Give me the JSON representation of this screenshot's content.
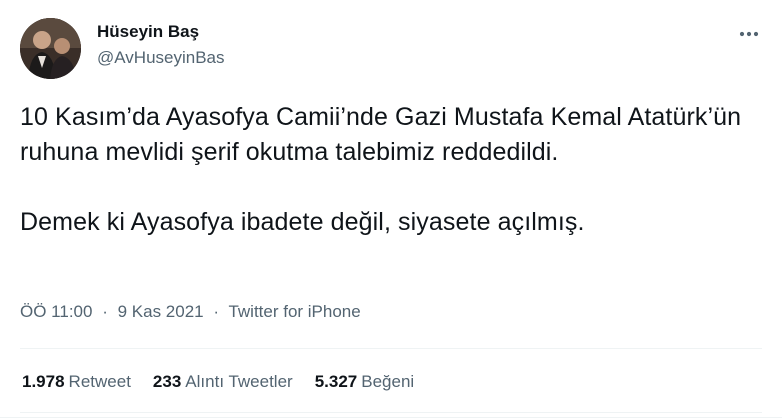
{
  "author": {
    "name": "Hüseyin Baş",
    "handle": "@AvHuseyinBas"
  },
  "more_icon": "more-horizontal-icon",
  "tweet": {
    "paragraphs": [
      "10 Kasım’da Ayasofya Camii’nde Gazi Mustafa Kemal Atatürk’ün ruhuna mevlidi şerif okutma talebimiz reddedildi.",
      "Demek ki Ayasofya ibadete değil, siyasete açılmış."
    ]
  },
  "meta": {
    "time": "ÖÖ 11:00",
    "separator": "·",
    "date": "9 Kas 2021",
    "source": "Twitter for iPhone"
  },
  "stats": {
    "retweets": {
      "count": "1.978",
      "label": "Retweet"
    },
    "quotes": {
      "count": "233",
      "label": "Alıntı Tweetler"
    },
    "likes": {
      "count": "5.327",
      "label": "Beğeni"
    }
  },
  "colors": {
    "text": "#0f1419",
    "secondary": "#536471",
    "divider": "#eff3f4"
  }
}
